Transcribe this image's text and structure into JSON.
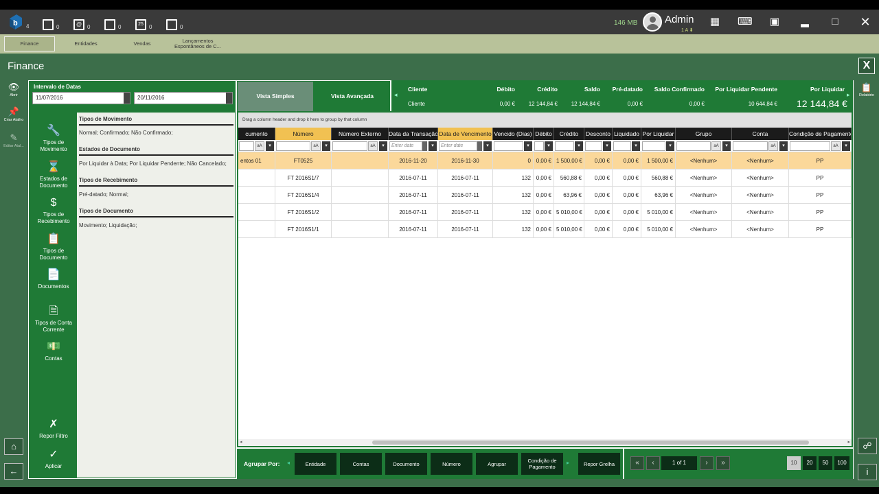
{
  "header": {
    "logo_count": "4",
    "counts": [
      "0",
      "0",
      "0",
      "0",
      "0"
    ],
    "memory": "146 MB",
    "user": "Admin",
    "user_sub": "1 A ⬇"
  },
  "module_tabs": [
    "Finance",
    "Entidades",
    "Vendas",
    "Lançamentos Espontâneos de C..."
  ],
  "workspace": {
    "title": "Finance",
    "close": "X"
  },
  "left_toolbar": {
    "open": "Abrir",
    "create_shortcut": "Criar Atalho",
    "edit_shortcut": "Editar Atal..."
  },
  "filters": {
    "date_label": "Intervalo de Datas",
    "date_from": "11/07/2016",
    "date_to": "20/11/2016",
    "categories": [
      "Tipos de Movimento",
      "Estados de Documento",
      "Tipos de Recebimento",
      "Tipos de Documento",
      "Documentos",
      "Tipos de Conta Corrente",
      "Contas"
    ],
    "reset": "Repor Filtro",
    "apply": "Aplicar",
    "sections": [
      {
        "title": "Tipos de Movimento",
        "value": "Normal; Confirmado; Não Confirmado;"
      },
      {
        "title": "Estados de Documento",
        "value": "Por Liquidar à Data; Por Liquidar Pendente; Não Cancelado;"
      },
      {
        "title": "Tipos de Recebimento",
        "value": "Pré-datado; Normal;"
      },
      {
        "title": "Tipos de Documento",
        "value": "Movimento; Liquidação;"
      }
    ]
  },
  "views": {
    "simple": "Vista Simples",
    "advanced": "Vista Avançada"
  },
  "summary": {
    "headers": [
      "Cliente",
      "Débito",
      "Crédito",
      "Saldo",
      "Pré-datado",
      "Saldo Confirmado",
      "Por Liquidar Pendente",
      "Por Liquidar"
    ],
    "values": [
      "Cliente",
      "0,00 €",
      "12 144,84 €",
      "12 144,84 €",
      "0,00 €",
      "0,00 €",
      "10 644,84 €"
    ],
    "total": "12 144,84 €"
  },
  "group_hint": "Drag a column header and drop it here to group by that column",
  "grid": {
    "columns": [
      "cumento",
      "Número",
      "Número Externo",
      "Data da Transação",
      "Data de Vencimento",
      "Vencido (Dias)",
      "Débito",
      "Crédito",
      "Desconto",
      "Liquidado",
      "Por Liquidar",
      "Grupo",
      "Conta",
      "Condição de Pagamento"
    ],
    "date_placeholder": "Enter date",
    "aa": "aA",
    "rows": [
      [
        "entos 01",
        "FT0525",
        "",
        "2016-11-20",
        "2016-11-30",
        "0",
        "0,00 €",
        "1 500,00 €",
        "0,00 €",
        "0,00 €",
        "1 500,00 €",
        "<Nenhum>",
        "<Nenhum>",
        "PP"
      ],
      [
        "",
        "FT 2016S1/7",
        "",
        "2016-07-11",
        "2016-07-11",
        "132",
        "0,00 €",
        "560,88 €",
        "0,00 €",
        "0,00 €",
        "560,88 €",
        "<Nenhum>",
        "<Nenhum>",
        "PP"
      ],
      [
        "",
        "FT 2016S1/4",
        "",
        "2016-07-11",
        "2016-07-11",
        "132",
        "0,00 €",
        "63,96 €",
        "0,00 €",
        "0,00 €",
        "63,96 €",
        "<Nenhum>",
        "<Nenhum>",
        "PP"
      ],
      [
        "",
        "FT 2016S1/2",
        "",
        "2016-07-11",
        "2016-07-11",
        "132",
        "0,00 €",
        "5 010,00 €",
        "0,00 €",
        "0,00 €",
        "5 010,00 €",
        "<Nenhum>",
        "<Nenhum>",
        "PP"
      ],
      [
        "",
        "FT 2016S1/1",
        "",
        "2016-07-11",
        "2016-07-11",
        "132",
        "0,00 €",
        "5 010,00 €",
        "0,00 €",
        "0,00 €",
        "5 010,00 €",
        "<Nenhum>",
        "<Nenhum>",
        "PP"
      ]
    ]
  },
  "bottom": {
    "group_by": "Agrupar Por:",
    "group_buttons": [
      "Entidade",
      "Contas",
      "Documento",
      "Número",
      "Agrupar",
      "Condição de Pagamento"
    ],
    "reset_grid": "Repor Grelha",
    "page": "1 of 1",
    "page_sizes": [
      "10",
      "20",
      "50",
      "100"
    ]
  },
  "right_toolbar": {
    "report": "Relatório"
  }
}
